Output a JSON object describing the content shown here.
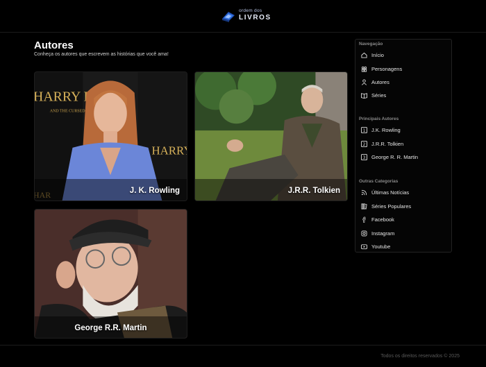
{
  "header": {
    "logo_small": "ordem dos",
    "logo_big": "LIVROS"
  },
  "main": {
    "title": "Autores",
    "subtitle": "Conheça os autores que escrevem as histórias que você ama!",
    "authors": [
      {
        "name": "J. K. Rowling"
      },
      {
        "name": "J.R.R. Tolkien"
      },
      {
        "name": "George R.R. Martin"
      }
    ]
  },
  "sidebar": {
    "nav_title": "Navegação",
    "nav_items": [
      {
        "label": "Início",
        "icon": "home-icon"
      },
      {
        "label": "Personagens",
        "icon": "people-icon"
      },
      {
        "label": "Autores",
        "icon": "user-icon"
      },
      {
        "label": "Séries",
        "icon": "book-open-icon"
      }
    ],
    "authors_title": "Principais Autores",
    "author_items": [
      {
        "label": "J.K. Rowling",
        "icon": "number-1-icon",
        "num": "1"
      },
      {
        "label": "J.R.R. Tolkien",
        "icon": "number-2-icon",
        "num": "2"
      },
      {
        "label": "George R. R. Martin",
        "icon": "number-3-icon",
        "num": "3"
      }
    ],
    "other_title": "Outras Categorias",
    "other_items": [
      {
        "label": "Últimas Notícias",
        "icon": "rss-icon"
      },
      {
        "label": "Séries Populares",
        "icon": "library-icon"
      },
      {
        "label": "Facebook",
        "icon": "facebook-icon"
      },
      {
        "label": "Instagram",
        "icon": "instagram-icon"
      },
      {
        "label": "Youtube",
        "icon": "youtube-icon"
      }
    ]
  },
  "footer": {
    "copyright": "Todos os direitos reservados © 2025"
  },
  "colors": {
    "background": "#000000",
    "logo_accent": "#3a6fd8"
  }
}
